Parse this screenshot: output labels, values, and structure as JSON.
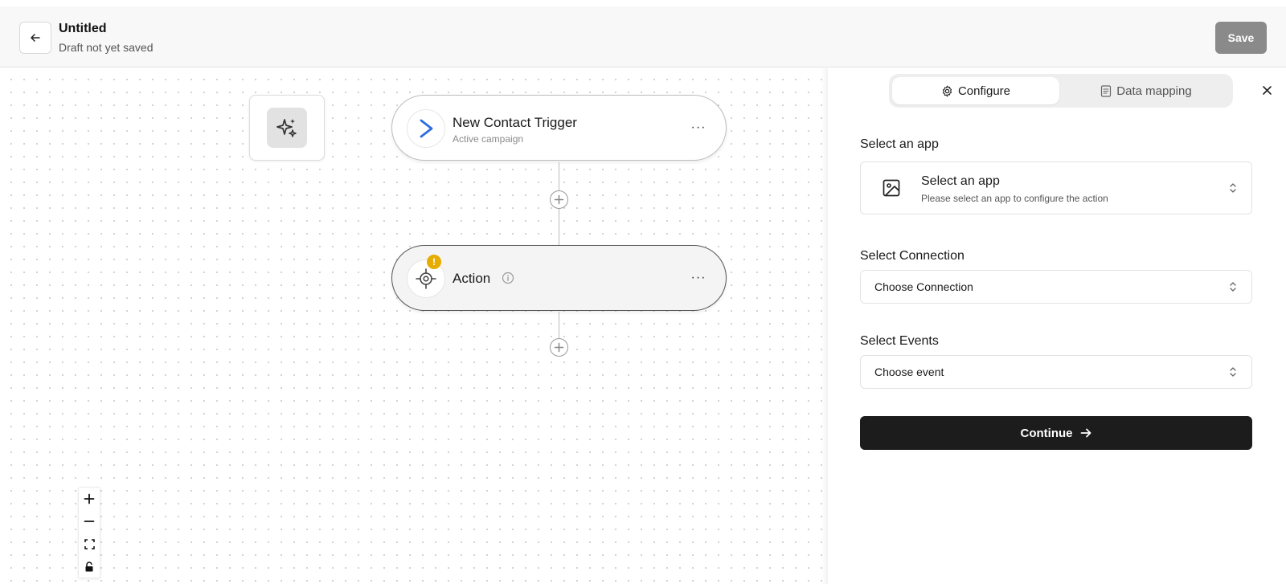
{
  "header": {
    "back_icon": "arrow-left-icon",
    "title": "Untitled",
    "subtitle": "Draft not yet saved",
    "save_label": "Save"
  },
  "canvas": {
    "ai_icon": "sparkles-icon",
    "trigger_node": {
      "title": "New Contact Trigger",
      "subtitle": "Active campaign",
      "icon": "activecampaign-chevron-icon",
      "menu_label": "···"
    },
    "action_node": {
      "title": "Action",
      "icon": "crosshair-icon",
      "warning_badge": "!",
      "menu_label": "···"
    },
    "zoom_controls": [
      "zoom-in",
      "zoom-out",
      "fit-view",
      "lock"
    ]
  },
  "panel": {
    "tabs": [
      {
        "label": "Configure",
        "icon": "gear-icon",
        "active": true
      },
      {
        "label": "Data mapping",
        "icon": "document-icon",
        "active": false
      }
    ],
    "select_app": {
      "label": "Select an app",
      "title": "Select an app",
      "subtitle": "Please select an app to configure the action",
      "icon": "image-icon"
    },
    "select_connection": {
      "label": "Select Connection",
      "value": "Choose Connection"
    },
    "select_events": {
      "label": "Select Events",
      "value": "Choose event"
    },
    "continue_label": "Continue"
  },
  "colors": {
    "save_button": "#8a8a8a",
    "continue_button": "#1c1c1c",
    "warning": "#e6ac00",
    "trigger_accent": "#2d6cdf"
  }
}
